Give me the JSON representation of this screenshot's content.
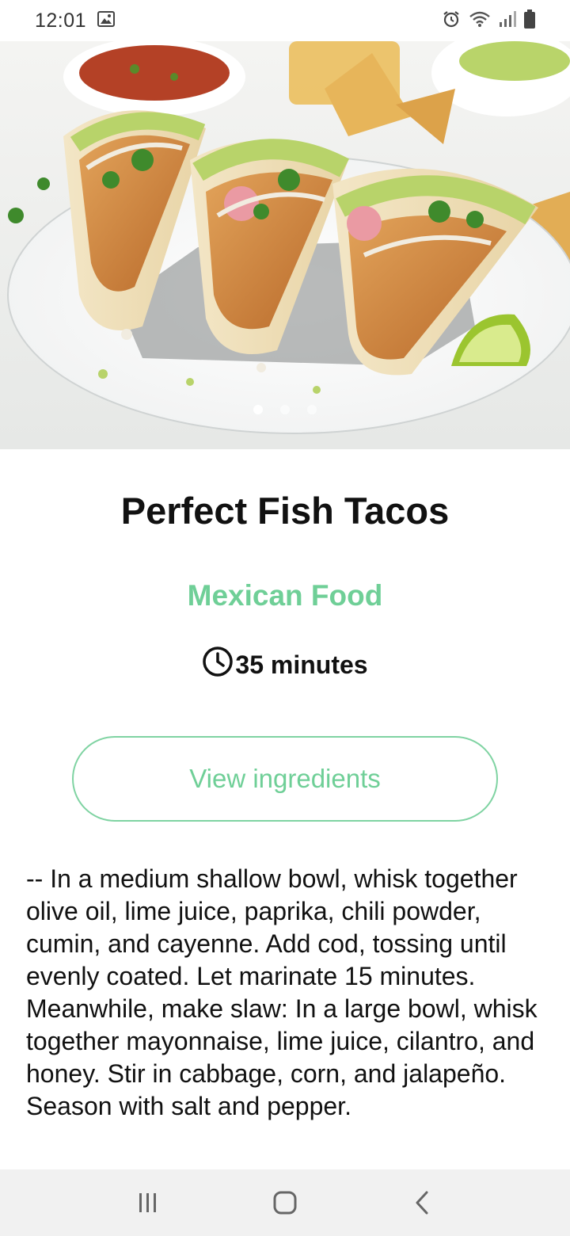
{
  "status_bar": {
    "time": "12:01",
    "left_icons": [
      "image-icon"
    ],
    "right_icons": [
      "alarm-icon",
      "wifi-icon",
      "signal-icon",
      "battery-icon"
    ]
  },
  "hero": {
    "subject": "fish-tacos-photo",
    "pager": {
      "count": 3,
      "active_index": 0
    }
  },
  "recipe": {
    "title": "Perfect Fish Tacos",
    "category": "Mexican Food",
    "time": "35 minutes",
    "time_icon": "clock-icon",
    "view_ingredients_label": "View ingredients",
    "instructions": "-- In a medium shallow bowl, whisk together olive oil, lime juice, paprika, chili powder, cumin, and cayenne. Add cod, tossing until evenly coated. Let marinate 15 minutes. Meanwhile, make slaw: In a large bowl, whisk together mayonnaise, lime juice, cilantro, and honey. Stir in cabbage, corn, and jalapeño. Season with salt and pepper."
  },
  "nav_bar": {
    "buttons": [
      "recents-icon",
      "home-icon",
      "back-icon"
    ]
  },
  "colors": {
    "accent": "#6fcf97",
    "button_border": "#7fd3a2",
    "nav_background": "#f1f1f1"
  }
}
